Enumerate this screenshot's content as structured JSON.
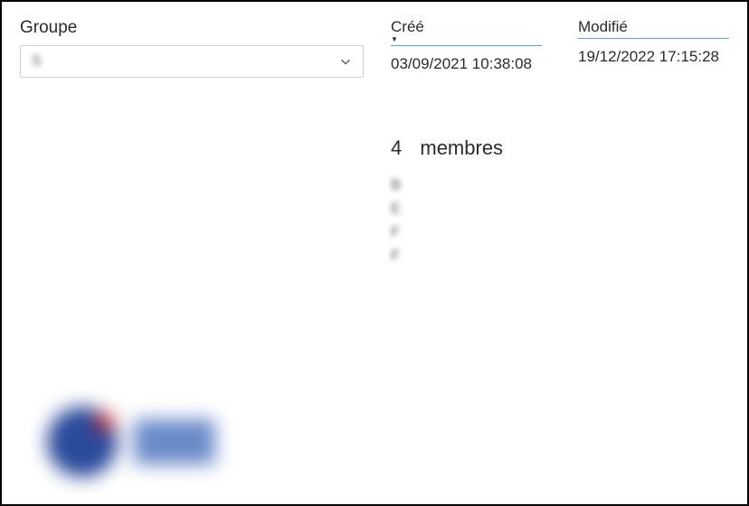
{
  "group": {
    "label": "Groupe",
    "selected": "S"
  },
  "meta": {
    "created": {
      "label": "Créé",
      "value": "03/09/2021 10:38:08"
    },
    "modified": {
      "label": "Modifié",
      "value": "19/12/2022 17:15:28"
    }
  },
  "members": {
    "count": "4",
    "label": "membres",
    "items": [
      "B",
      "E",
      "F",
      "F"
    ]
  }
}
